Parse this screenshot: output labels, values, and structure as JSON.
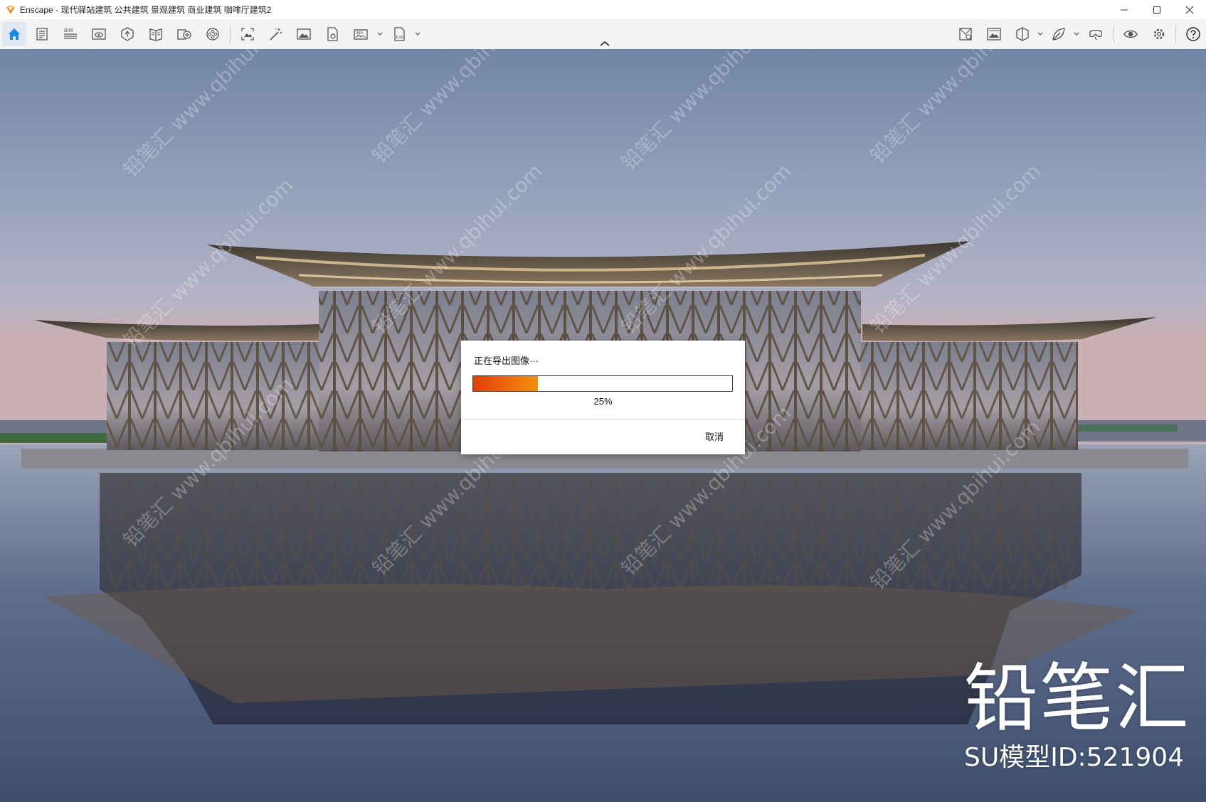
{
  "window": {
    "title": "Enscape - 现代驿站建筑 公共建筑 景观建筑 商业建筑 咖啡厅建筑2",
    "icon": "enscape-logo-icon",
    "controls": [
      "minimize-icon",
      "maximize-icon",
      "close-icon"
    ]
  },
  "toolbar": {
    "left_icons": [
      "home-icon",
      "notes-icon",
      "bim-icon",
      "views-icon",
      "asset-library-icon",
      "material-editor-icon",
      "site-context-icon",
      "video-editor-icon",
      "panorama-capture-icon",
      "batch-render-icon",
      "screenshot-icon",
      "export-image-icon",
      "export-360-icon",
      "export-exe-icon"
    ],
    "bim_label": "BIM",
    "pano_label": "360",
    "exe_label": "EXE",
    "right_icons": [
      "view-management-icon",
      "visual-settings-icon",
      "cube-view-icon",
      "leaf-icon",
      "vr-headset-icon",
      "eye-icon",
      "settings-icon",
      "help-icon"
    ],
    "active": "home-icon"
  },
  "dialog": {
    "title": "正在导出图像···",
    "progress": 0.25,
    "progress_text": "25%",
    "cancel_label": "取消",
    "colors": {
      "fill_start": "#e13d0b",
      "fill_end": "#f4900d"
    }
  },
  "watermark": {
    "brand": "铅笔汇",
    "model_id": "SU模型ID:521904",
    "tile_text": "铅笔汇 www.qbihui.com"
  }
}
